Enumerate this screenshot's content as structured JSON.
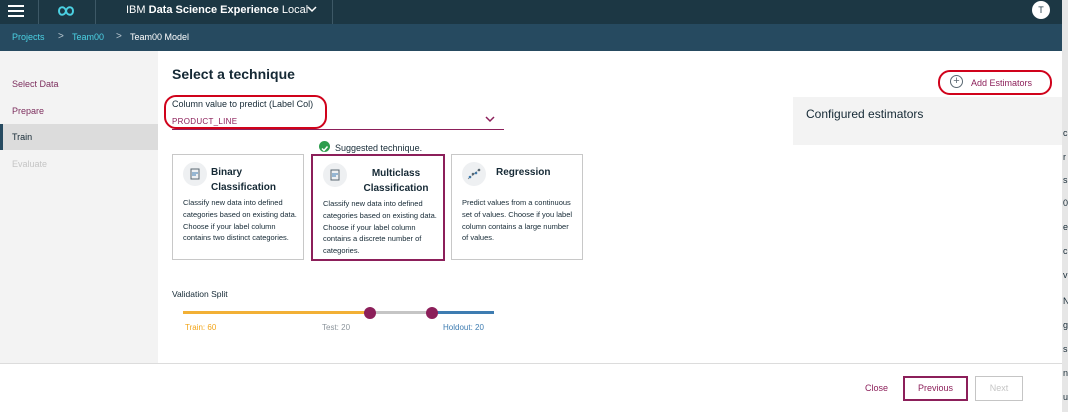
{
  "header": {
    "app_title_prefix": "IBM ",
    "app_title_bold": "Data Science Experience",
    "app_title_suffix": " Local",
    "avatar_initial": "T"
  },
  "breadcrumb": [
    "Projects",
    "Team00",
    "Team00 Model"
  ],
  "breadcrumb_sep": ">",
  "sidebar": {
    "items": [
      {
        "label": "Select Data",
        "state": "normal"
      },
      {
        "label": "Prepare",
        "state": "normal"
      },
      {
        "label": "Train",
        "state": "active"
      },
      {
        "label": "Evaluate",
        "state": "disabled"
      }
    ]
  },
  "main": {
    "heading": "Select a technique",
    "label_col_label": "Column value to predict (Label Col)",
    "label_col_value": "PRODUCT_LINE",
    "suggested_text": "Suggested technique.",
    "cards": [
      {
        "title": "Binary Classification",
        "desc": "Classify new data into defined categories based on existing data. Choose if your label column contains two distinct categories.",
        "selected": false
      },
      {
        "title": "Multiclass Classification",
        "desc": "Classify new data into defined categories based on existing data. Choose if your label column contains a discrete number of categories.",
        "selected": true
      },
      {
        "title": "Regression",
        "desc": "Predict values from a continuous set of values. Choose if you label column contains a large number of values.",
        "selected": false
      }
    ],
    "validation_split": {
      "label": "Validation Split",
      "train_label": "Train: 60",
      "test_label": "Test: 20",
      "holdout_label": "Holdout: 20",
      "train": 60,
      "test": 20,
      "holdout": 20
    }
  },
  "right_panel": {
    "add_estimators": "Add Estimators",
    "configured_estimators": "Configured estimators"
  },
  "footer": {
    "close": "Close",
    "previous": "Previous",
    "next": "Next"
  },
  "colors": {
    "accent": "#8c1f5a",
    "header_bg": "#1c3744",
    "breadcrumb_bg": "#264a60",
    "breadcrumb_link": "#4bd1e3",
    "train_track": "#f2b035",
    "test_track": "#c5c5c5",
    "holdout_track": "#3e7cb1",
    "annotation": "#d0021b",
    "check": "#2e9d4d"
  },
  "edge_clipped_chars": [
    "c",
    "r",
    "s",
    "0",
    "e",
    "c",
    "v",
    "N",
    "g",
    "s",
    "n",
    "u"
  ]
}
